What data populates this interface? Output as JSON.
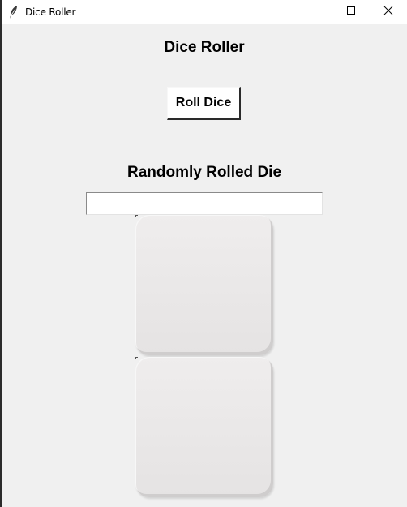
{
  "window": {
    "title": "Dice Roller",
    "icon": "feather-icon",
    "controls": {
      "minimize_icon": "minimize-icon",
      "maximize_icon": "maximize-icon",
      "close_icon": "close-icon"
    }
  },
  "main": {
    "heading": "Dice Roller",
    "roll_button_label": "Roll Dice",
    "result_heading": "Randomly Rolled Die",
    "result_value": "",
    "dice": [
      {
        "face": "blank"
      },
      {
        "face": "blank"
      }
    ]
  },
  "colors": {
    "window_background": "#f0f0f0",
    "titlebar_background": "#ffffff",
    "button_background": "#ffffff",
    "die_face": "#ebe9e9"
  }
}
